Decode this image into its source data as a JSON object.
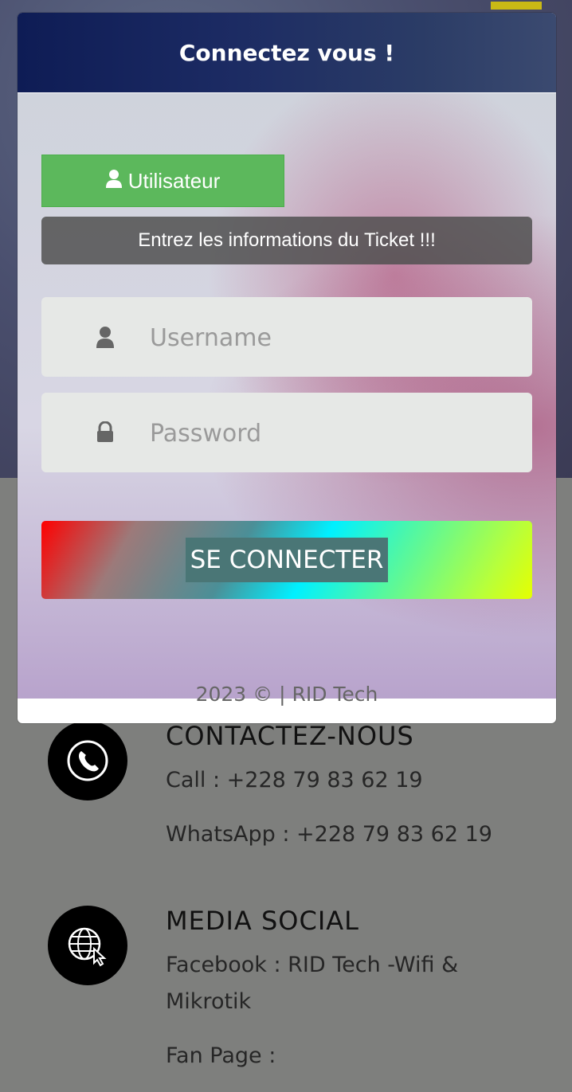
{
  "modal": {
    "title": "Connectez vous !",
    "user_tab_label": "Utilisateur",
    "info_text": "Entrez les informations du Ticket !!!",
    "username_placeholder": "Username",
    "password_placeholder": "Password",
    "connect_label": "SE CONNECTER",
    "footer": "2023 © | RID Tech"
  },
  "contact": {
    "title": "CONTACTEZ-NOUS",
    "call": "Call : +228 79 83 62 19",
    "whatsapp": "WhatsApp : +228 79 83 62 19"
  },
  "social": {
    "title": "MEDIA SOCIAL",
    "facebook": "Facebook : RID Tech -Wifi & Mikrotik",
    "fan_page": "Fan Page :"
  },
  "colors": {
    "header": "#0e1c55",
    "user_button": "#5cb85c",
    "field_bg": "#e6e8e6"
  },
  "icons": [
    "user-icon",
    "lock-icon",
    "phone-icon",
    "globe-cursor-icon"
  ]
}
